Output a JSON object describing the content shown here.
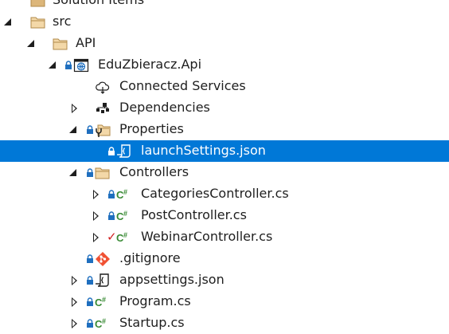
{
  "solution_explorer": {
    "items": [
      {
        "id": "solution-items",
        "label": "Solution Items",
        "icon": "folder-icon",
        "expander": "none",
        "status": "none"
      },
      {
        "id": "src",
        "label": "src",
        "icon": "folder-icon",
        "expander": "open",
        "status": "none"
      },
      {
        "id": "api",
        "label": "API",
        "icon": "folder-icon",
        "expander": "open",
        "status": "none"
      },
      {
        "id": "project",
        "label": "EduZbieracz.Api",
        "icon": "web-project-icon",
        "expander": "open",
        "status": "locked"
      },
      {
        "id": "connected-services",
        "label": "Connected Services",
        "icon": "connected-services-icon",
        "expander": "none",
        "status": "none"
      },
      {
        "id": "dependencies",
        "label": "Dependencies",
        "icon": "dependencies-icon",
        "expander": "closed",
        "status": "none"
      },
      {
        "id": "properties",
        "label": "Properties",
        "icon": "properties-folder-icon",
        "expander": "open",
        "status": "locked"
      },
      {
        "id": "launch-settings",
        "label": "launchSettings.json",
        "icon": "json-file-icon",
        "expander": "none",
        "status": "locked",
        "selected": true
      },
      {
        "id": "controllers",
        "label": "Controllers",
        "icon": "folder-icon",
        "expander": "open",
        "status": "locked"
      },
      {
        "id": "categories-controller",
        "label": "CategoriesController.cs",
        "icon": "csharp-file-icon",
        "expander": "closed",
        "status": "locked"
      },
      {
        "id": "post-controller",
        "label": "PostController.cs",
        "icon": "csharp-file-icon",
        "expander": "closed",
        "status": "locked"
      },
      {
        "id": "webinar-controller",
        "label": "WebinarController.cs",
        "icon": "csharp-file-icon",
        "expander": "closed",
        "status": "checked-out"
      },
      {
        "id": "gitignore",
        "label": ".gitignore",
        "icon": "git-icon",
        "expander": "none",
        "status": "locked"
      },
      {
        "id": "appsettings",
        "label": "appsettings.json",
        "icon": "json-file-icon",
        "expander": "closed",
        "status": "locked"
      },
      {
        "id": "program",
        "label": "Program.cs",
        "icon": "csharp-file-icon",
        "expander": "closed",
        "status": "locked"
      },
      {
        "id": "startup",
        "label": "Startup.cs",
        "icon": "csharp-file-icon",
        "expander": "closed",
        "status": "locked"
      }
    ],
    "checked_out_glyph": "✓"
  },
  "colors": {
    "selection": "#0078d7",
    "folder": "#dcb67a",
    "csharp": "#388a34",
    "git": "#f05133",
    "lock": "#1f6fbf",
    "checked_out": "#d02020"
  }
}
